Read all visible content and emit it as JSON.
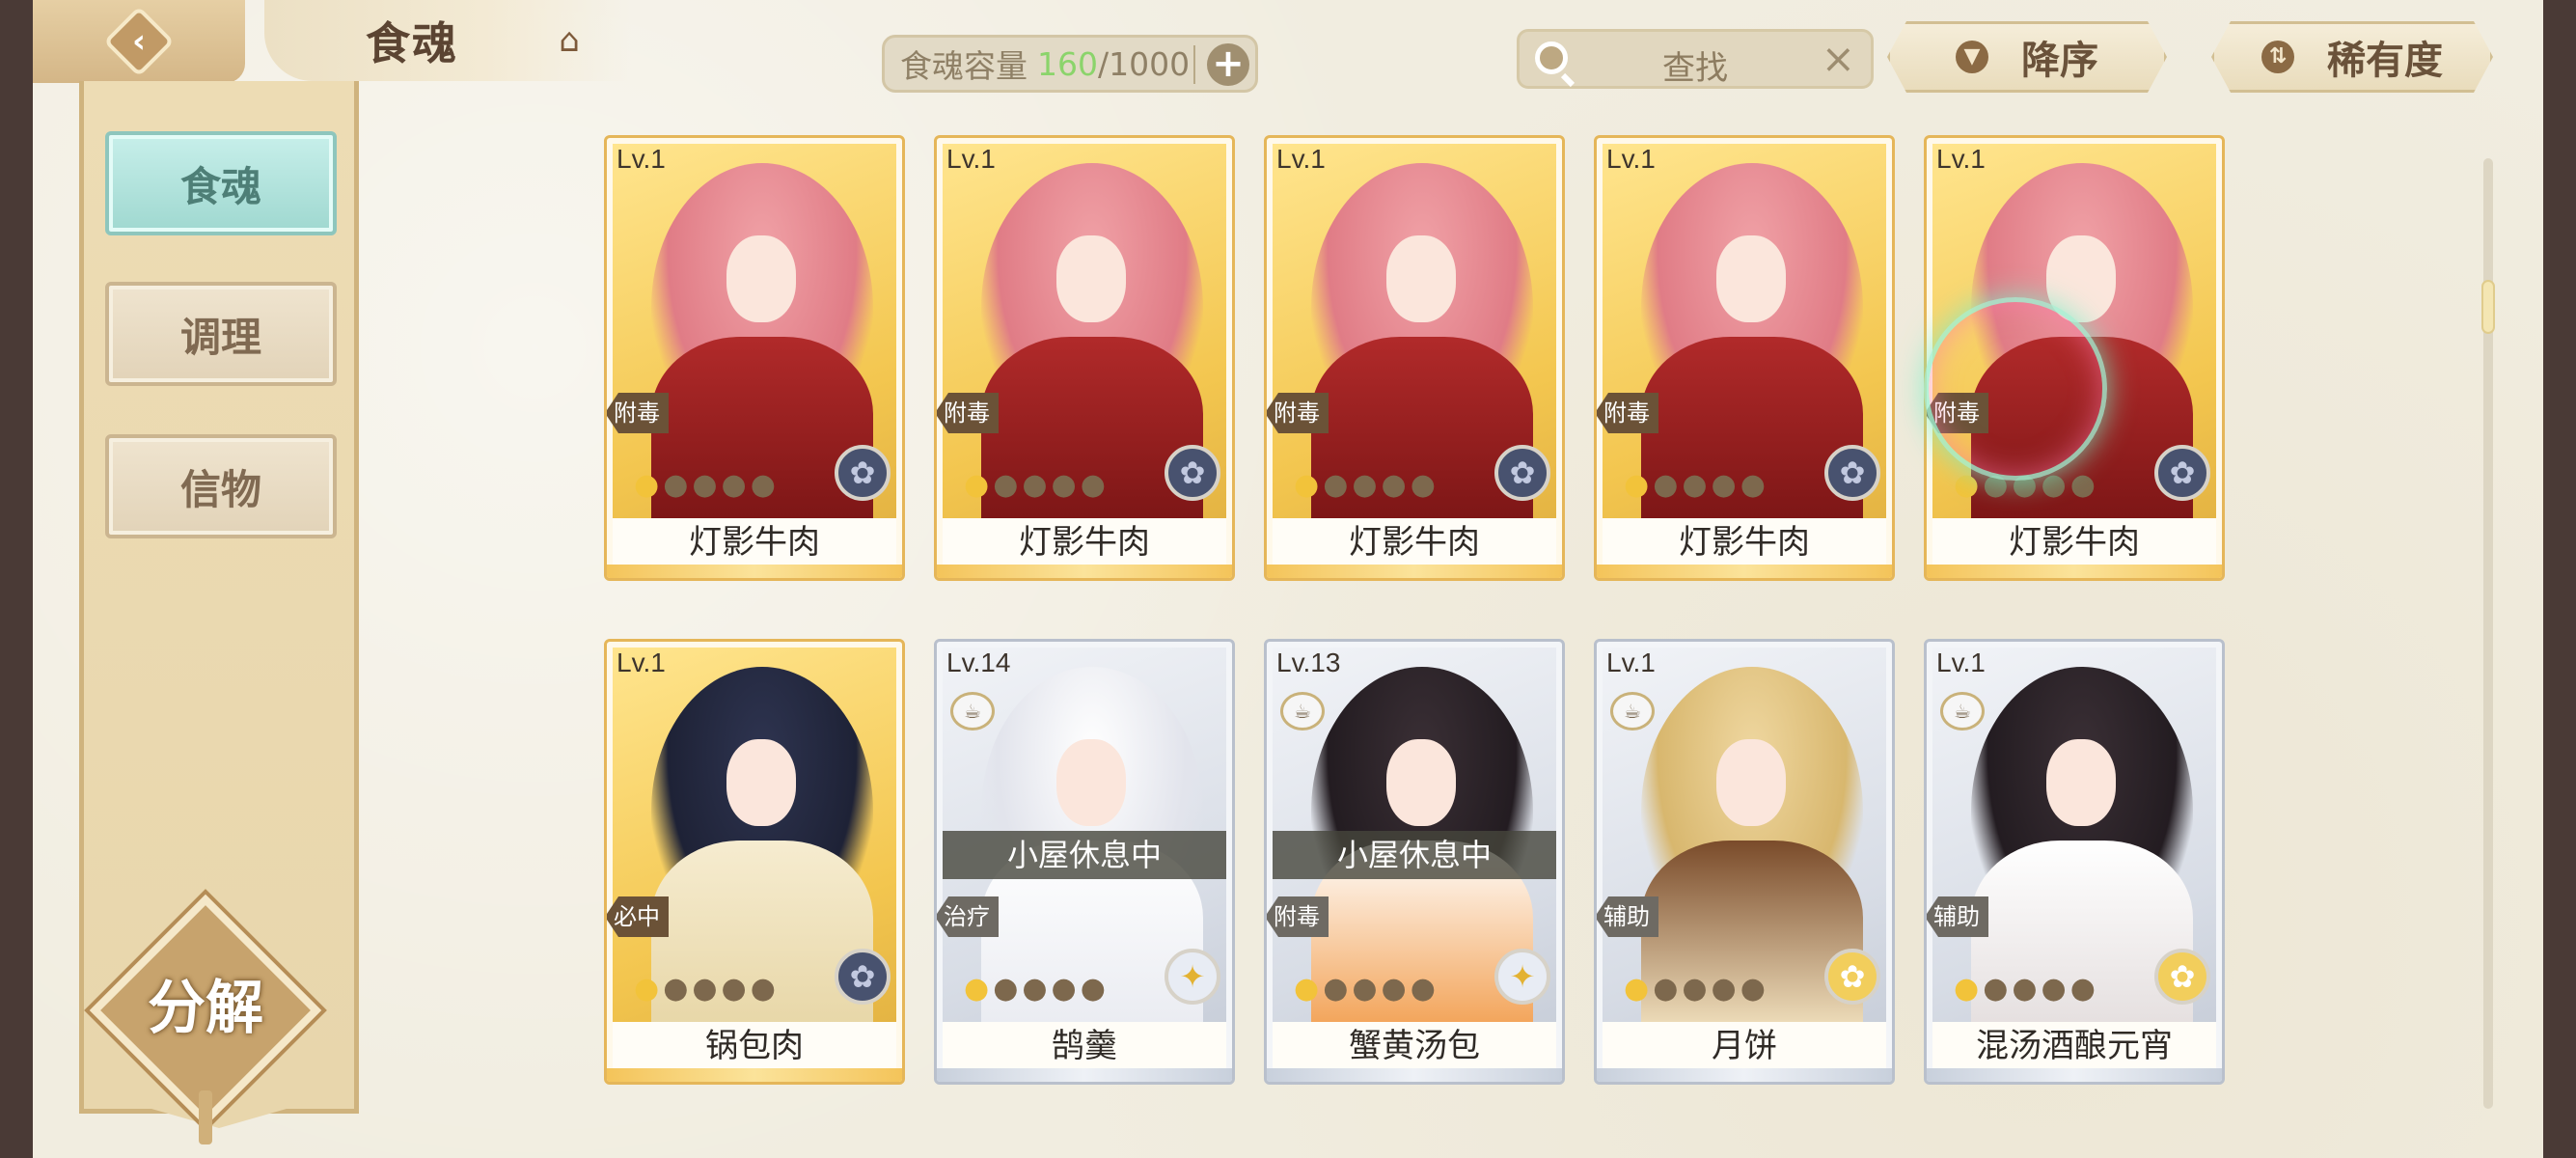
{
  "header": {
    "back_label": "back",
    "title": "食魂",
    "capacity_label": "食魂容量",
    "capacity_current": "160",
    "capacity_sep": "/",
    "capacity_max": "1000",
    "search_placeholder": "查找",
    "sort_order_label": "降序",
    "sort_key_label": "稀有度"
  },
  "sidebar": {
    "tabs": [
      {
        "label": "食魂",
        "active": true
      },
      {
        "label": "调理",
        "active": false
      },
      {
        "label": "信物",
        "active": false
      }
    ],
    "decompose_label": "分解"
  },
  "cards": [
    {
      "level": "Lv.1",
      "role": "附毒",
      "name": "灯影牛肉",
      "rarity": "gold",
      "stars_filled": 1,
      "stars_total": 5,
      "status": ""
    },
    {
      "level": "Lv.1",
      "role": "附毒",
      "name": "灯影牛肉",
      "rarity": "gold",
      "stars_filled": 1,
      "stars_total": 5,
      "status": ""
    },
    {
      "level": "Lv.1",
      "role": "附毒",
      "name": "灯影牛肉",
      "rarity": "gold",
      "stars_filled": 1,
      "stars_total": 5,
      "status": ""
    },
    {
      "level": "Lv.1",
      "role": "附毒",
      "name": "灯影牛肉",
      "rarity": "gold",
      "stars_filled": 1,
      "stars_total": 5,
      "status": ""
    },
    {
      "level": "Lv.1",
      "role": "附毒",
      "name": "灯影牛肉",
      "rarity": "gold",
      "stars_filled": 1,
      "stars_total": 5,
      "status": ""
    },
    {
      "level": "Lv.1",
      "role": "必中",
      "name": "锅包肉",
      "rarity": "gold",
      "stars_filled": 1,
      "stars_total": 5,
      "status": ""
    },
    {
      "level": "Lv.14",
      "role": "治疗",
      "name": "鹄羹",
      "rarity": "silver",
      "stars_filled": 1,
      "stars_total": 5,
      "status": "小屋休息中"
    },
    {
      "level": "Lv.13",
      "role": "附毒",
      "name": "蟹黄汤包",
      "rarity": "silver",
      "stars_filled": 1,
      "stars_total": 5,
      "status": "小屋休息中"
    },
    {
      "level": "Lv.1",
      "role": "辅助",
      "name": "月饼",
      "rarity": "silver",
      "stars_filled": 1,
      "stars_total": 5,
      "status": ""
    },
    {
      "level": "Lv.1",
      "role": "辅助",
      "name": "混汤酒酿元宵",
      "rarity": "silver",
      "stars_filled": 1,
      "stars_total": 5,
      "status": ""
    }
  ],
  "colors": {
    "gold_border": "#e5b659",
    "silver_border": "#b9c0cc",
    "capacity_current": "#8bd46b",
    "active_tab": "#9fd8d0"
  }
}
